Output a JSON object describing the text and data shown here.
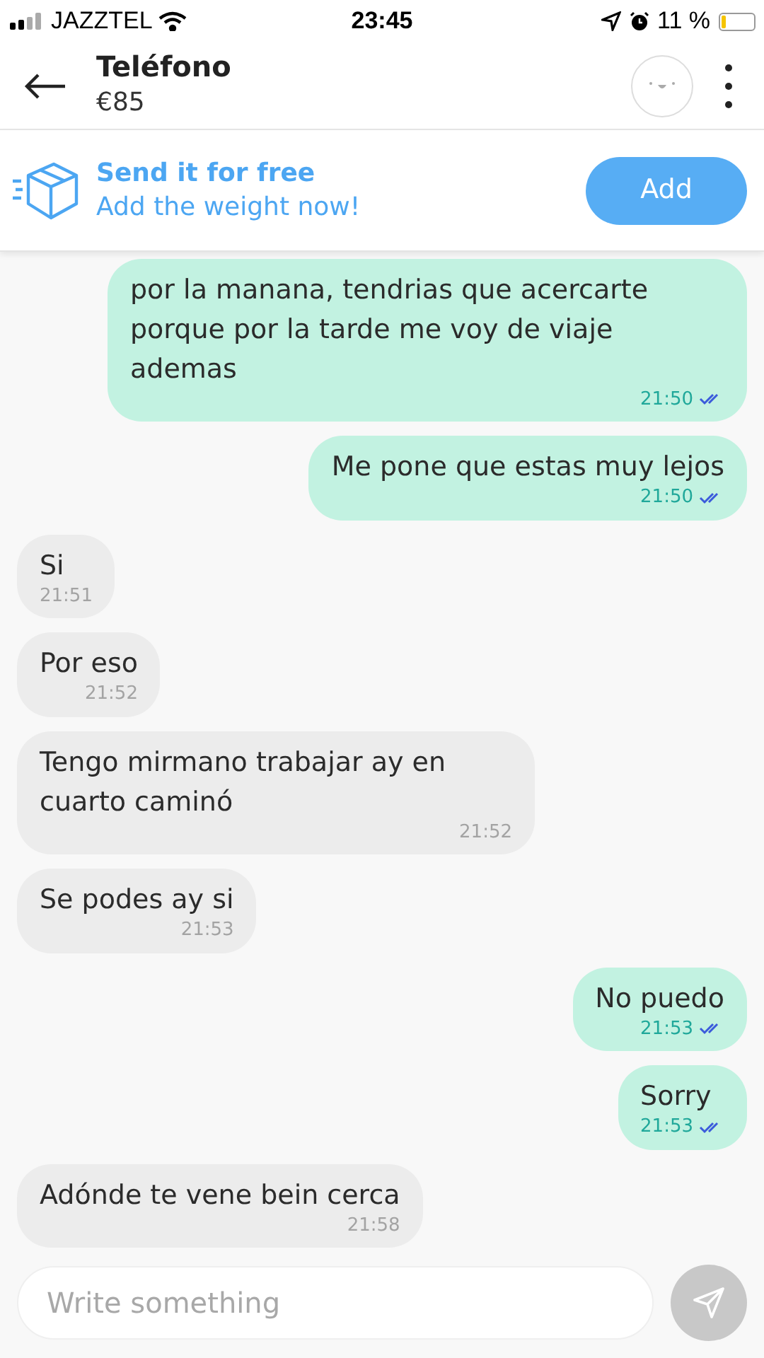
{
  "status_bar": {
    "carrier": "JAZZTEL",
    "time": "23:45",
    "battery": "11 %"
  },
  "header": {
    "title": "Teléfono",
    "price": "€85"
  },
  "banner": {
    "title": "Send it for free",
    "subtitle": "Add the weight now!",
    "button": "Add"
  },
  "messages": [
    {
      "kind": "sent",
      "text": "por la manana, tendrias que acercarte porque por la tarde me voy de viaje ademas",
      "time": "21:50",
      "read": true
    },
    {
      "kind": "sent",
      "text": "Me pone que estas muy lejos",
      "time": "21:50",
      "read": true
    },
    {
      "kind": "received",
      "text": "Si",
      "time": "21:51"
    },
    {
      "kind": "received",
      "text": "Por eso",
      "time": "21:52"
    },
    {
      "kind": "received",
      "text": "Tengo mirmano trabajar ay en cuarto caminó",
      "time": "21:52"
    },
    {
      "kind": "received",
      "text": "Se podes ay si",
      "time": "21:53"
    },
    {
      "kind": "sent",
      "text": "No puedo",
      "time": "21:53",
      "read": true
    },
    {
      "kind": "sent",
      "text": "Sorry",
      "time": "21:53",
      "read": true
    },
    {
      "kind": "received",
      "text": "Adónde te vene bein cerca",
      "time": "21:58"
    }
  ],
  "composer": {
    "placeholder": "Write something"
  }
}
